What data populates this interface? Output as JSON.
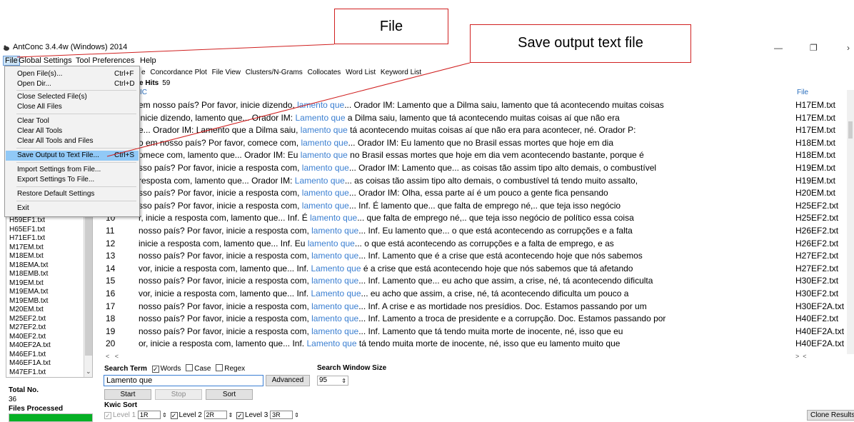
{
  "window": {
    "title": "AntConc 3.4.4w (Windows) 2014",
    "restore_glyph": "❐",
    "minimize_glyph": "—",
    "close_glyph": "›"
  },
  "menubar": {
    "items": [
      "File",
      "Global Settings",
      "Tool Preferences",
      "Help"
    ]
  },
  "file_menu": {
    "entries": [
      {
        "label": "Open File(s)...",
        "shortcut": "Ctrl+F"
      },
      {
        "label": "Open Dir...",
        "shortcut": "Ctrl+D"
      },
      {
        "label": "Close Selected File(s)",
        "shortcut": ""
      },
      {
        "label": "Close All Files",
        "shortcut": ""
      },
      {
        "label": "Clear Tool",
        "shortcut": ""
      },
      {
        "label": "Clear All Tools",
        "shortcut": ""
      },
      {
        "label": "Clear All Tools and Files",
        "shortcut": ""
      },
      {
        "label": "Save Output to Text File...",
        "shortcut": "Ctrl+S"
      },
      {
        "label": "Import Settings from File...",
        "shortcut": ""
      },
      {
        "label": "Export Settings To File...",
        "shortcut": ""
      },
      {
        "label": "Restore Default Settings",
        "shortcut": ""
      },
      {
        "label": "Exit",
        "shortcut": ""
      }
    ]
  },
  "tabs": {
    "partial_first": "e",
    "items": [
      "Concordance Plot",
      "File View",
      "Clusters/N-Grams",
      "Collocates",
      "Word List",
      "Keyword List"
    ]
  },
  "concordance": {
    "hits_label": "e Hits",
    "hits_count": "59",
    "kwic_header": "IC",
    "file_header": "File"
  },
  "file_list": [
    "H59EF1.txt",
    "H65EF1.txt",
    "H71EF1.txt",
    "M17EM.txt",
    "M18EM.txt",
    "M18EMA.txt",
    "M18EMB.txt",
    "M19EM.txt",
    "M19EMA.txt",
    "M19EMB.txt",
    "M20EM.txt",
    "M25EF2.txt",
    "M27EF2.txt",
    "M40EF2.txt",
    "M40EF2A.txt",
    "M46EF1.txt",
    "M46EF1A.txt",
    "M47EF1.txt"
  ],
  "rows": [
    {
      "num": "",
      "left": "em nosso país? Por favor, inicie dizendo,",
      "kw": "lamento que",
      "right": "... Orador IM: Lamento que a Dilma saiu, lamento que tá acontecendo muitas coisas",
      "file": "H17EM.txt"
    },
    {
      "num": "",
      "left": "inicie dizendo, lamento que... Orador IM:",
      "kw": "Lamento que",
      "right": " a Dilma saiu, lamento que tá acontecendo muitas coisas aí que não era",
      "file": "H17EM.txt"
    },
    {
      "num": "",
      "left": "e... Orador IM: Lamento que a Dilma saiu,",
      "kw": "lamento que",
      "right": " tá acontecendo muitas coisas aí que não era para acontecer, né. Orador P:",
      "file": "H17EM.txt"
    },
    {
      "num": "",
      "left": "o em nosso país? Por favor, comece com,",
      "kw": "lamento que",
      "right": "... Orador IM: Eu lamento que no Brasil essas mortes que hoje em dia",
      "file": "H18EM.txt"
    },
    {
      "num": "",
      "left": "omece com, lamento que... Orador IM: Eu",
      "kw": "lamento que",
      "right": " no Brasil essas mortes que hoje em dia vem acontecendo bastante, porque é",
      "file": "H18EM.txt"
    },
    {
      "num": "",
      "left": "sso país? Por favor, inicie a resposta com,",
      "kw": "lamento que",
      "right": "... Orador IM: Lamento que... as coisas tão assim tipo alto demais, o combustível",
      "file": "H19EM.txt"
    },
    {
      "num": "",
      "left": "resposta com, lamento que... Orador IM:",
      "kw": "Lamento que",
      "right": "... as coisas tão assim tipo alto demais, o combustível tá tendo muito assalto,",
      "file": "H19EM.txt"
    },
    {
      "num": "",
      "left": "sso país? Por favor, inicie a resposta com,",
      "kw": "lamento que",
      "right": "... Orador IM: Olha, essa parte aí é um pouco a gente fica pensando",
      "file": "H20EM.txt"
    },
    {
      "num": "",
      "left": "sso país? Por favor, inicie a resposta com,",
      "kw": "lamento que",
      "right": "... Inf. É lamento que... que falta de emprego né,.. que teja isso negócio",
      "file": "H25EF2.txt"
    },
    {
      "num": "10",
      "left": "r, inicie a resposta com, lamento que... Inf. É",
      "kw": "lamento que",
      "right": "... que falta de emprego né,.. que teja isso negócio de político essa coisa",
      "file": "H25EF2.txt"
    },
    {
      "num": "11",
      "left": "nosso país? Por favor, inicie a resposta com,",
      "kw": "lamento que",
      "right": "... Inf. Eu lamento que... o que está acontecendo as corrupções e a falta",
      "file": "H26EF2.txt"
    },
    {
      "num": "12",
      "left": "inicie a resposta com, lamento que... Inf. Eu",
      "kw": "lamento que",
      "right": "... o que está acontecendo as corrupções e a falta de emprego, e as",
      "file": "H26EF2.txt"
    },
    {
      "num": "13",
      "left": "nosso país? Por favor, inicie a resposta com,",
      "kw": "lamento que",
      "right": "... Inf. Lamento que é a crise que está acontecendo hoje que nós sabemos",
      "file": "H27EF2.txt"
    },
    {
      "num": "14",
      "left": "vor, inicie a resposta com, lamento que... Inf.",
      "kw": "Lamento que",
      "right": " é a crise que está acontecendo hoje que nós sabemos que tá afetando",
      "file": "H27EF2.txt"
    },
    {
      "num": "15",
      "left": "nosso país? Por favor, inicie a resposta com,",
      "kw": "lamento que",
      "right": "... Inf. Lamento que... eu acho que assim, a crise, né, tá acontecendo dificulta",
      "file": "H30EF2.txt"
    },
    {
      "num": "16",
      "left": "vor, inicie a resposta com, lamento que... Inf.",
      "kw": "Lamento que",
      "right": "... eu acho que assim, a crise, né, tá acontecendo dificulta um pouco a",
      "file": "H30EF2.txt"
    },
    {
      "num": "17",
      "left": "nosso país? Por favor, inicie a resposta com,",
      "kw": "lamento que",
      "right": "... Inf. A crise e as mortidade nos presídios. Doc. Estamos passando por um",
      "file": "H30EF2A.txt"
    },
    {
      "num": "18",
      "left": "nosso país? Por favor, inicie a resposta com,",
      "kw": "lamento que",
      "right": "... Inf. Lamento a troca de presidente e a corrupção. Doc. Estamos passando por",
      "file": "H40EF2.txt"
    },
    {
      "num": "19",
      "left": "nosso país? Por favor, inicie a resposta com,",
      "kw": "lamento que",
      "right": "... Inf. Lamento que tá tendo muita morte de inocente, né, isso que eu",
      "file": "H40EF2A.txt"
    },
    {
      "num": "20",
      "left": "or, inicie a resposta com, lamento que... Inf.",
      "kw": "Lamento que",
      "right": " tá tendo muita morte de inocente, né, isso que eu lamento muito que",
      "file": "H40EF2A.txt"
    }
  ],
  "search": {
    "term_label": "Search Term",
    "words_label": "Words",
    "case_label": "Case",
    "regex_label": "Regex",
    "words_checked": true,
    "case_checked": false,
    "regex_checked": false,
    "value": "Lamento que",
    "advanced_label": "Advanced",
    "window_size_label": "Search Window Size",
    "window_size_value": "95"
  },
  "buttons": {
    "start": "Start",
    "stop": "Stop",
    "sort": "Sort",
    "clone": "Clone Results"
  },
  "kwic_sort": {
    "label": "Kwic Sort",
    "level1_label": "Level 1",
    "level1_value": "1R",
    "level2_label": "Level 2",
    "level2_value": "2R",
    "level3_label": "Level 3",
    "level3_value": "3R"
  },
  "stats": {
    "total_label": "Total No.",
    "total_value": "36",
    "processed_label": "Files Processed",
    "processed_fraction": 1.0
  },
  "annotations": {
    "file_callout": "File",
    "save_callout": "Save output text file"
  },
  "colors": {
    "keyword": "#3b7fd1",
    "progress": "#06b025",
    "menu_highlight": "#91c9f7",
    "callout_border": "#d02020"
  }
}
